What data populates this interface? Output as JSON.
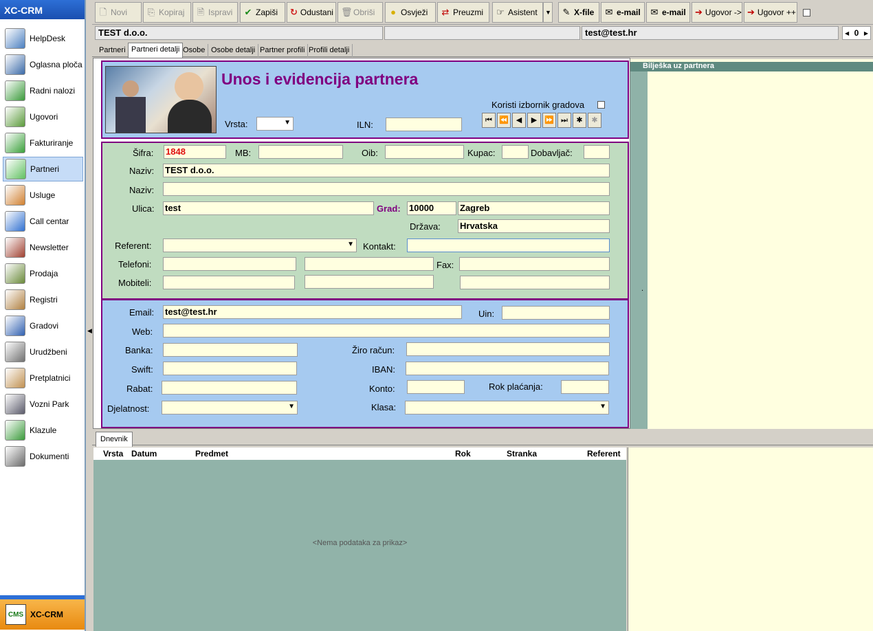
{
  "app": {
    "title": "XC-CRM"
  },
  "sidebar": {
    "items": [
      {
        "label": "HelpDesk"
      },
      {
        "label": "Oglasna ploča"
      },
      {
        "label": "Radni nalozi"
      },
      {
        "label": "Ugovori"
      },
      {
        "label": "Fakturiranje"
      },
      {
        "label": "Partneri"
      },
      {
        "label": "Usluge"
      },
      {
        "label": "Call centar"
      },
      {
        "label": "Newsletter"
      },
      {
        "label": "Prodaja"
      },
      {
        "label": "Registri"
      },
      {
        "label": "Gradovi"
      },
      {
        "label": "Urudžbeni"
      },
      {
        "label": "Pretplatnici"
      },
      {
        "label": "Vozni Park"
      },
      {
        "label": "Klazule"
      },
      {
        "label": "Dokumenti"
      }
    ],
    "active": "Partneri",
    "footer_label": "XC-CRM",
    "footer_logo": "CMS"
  },
  "toolbar": {
    "novi": "Novi",
    "kopiraj": "Kopiraj",
    "ispravi": "Ispravi",
    "zapisi": "Zapiši",
    "odustani": "Odustani",
    "obrisi": "Obriši",
    "osvjezi": "Osvježi",
    "preuzmi": "Preuzmi",
    "asistent": "Asistent",
    "xfile": "X-file",
    "email1": "e-mail",
    "email2": "e-mail",
    "ugovor1": "Ugovor ->",
    "ugovor2": "Ugovor ++"
  },
  "infobar": {
    "partner": "TEST d.o.o.",
    "middle": "",
    "email": "test@test.hr",
    "counter": "0"
  },
  "tabs": [
    "Partneri",
    "Partneri detalji",
    "Osobe",
    "Osobe detalji",
    "Partner profili",
    "Profili detalji"
  ],
  "header": {
    "title": "Unos i evidencija partnera",
    "vrsta_label": "Vrsta:",
    "vrsta_value": "",
    "iln_label": "ILN:",
    "iln_value": "",
    "gradovi_label": "Koristi izbornik gradova"
  },
  "form": {
    "sifra_label": "Šifra:",
    "sifra": "1848",
    "mb_label": "MB:",
    "mb": "",
    "oib_label": "Oib:",
    "oib": "",
    "kupac_label": "Kupac:",
    "kupac": "",
    "dobavljac_label": "Dobavljač:",
    "dobavljac": "",
    "naziv_label": "Naziv:",
    "naziv": "TEST d.o.o.",
    "naziv2_label": "Naziv:",
    "naziv2": "",
    "ulica_label": "Ulica:",
    "ulica": "test",
    "grad_label": "Grad:",
    "postanski": "10000",
    "grad": "Zagreb",
    "drzava_label": "Država:",
    "drzava": "Hrvatska",
    "referent_label": "Referent:",
    "referent": "",
    "kontakt_label": "Kontakt:",
    "kontakt": "",
    "telefoni_label": "Telefoni:",
    "fax_label": "Fax:",
    "mobiteli_label": "Mobiteli:"
  },
  "contact": {
    "email_label": "Email:",
    "email": "test@test.hr",
    "uin_label": "Uin:",
    "uin": "",
    "web_label": "Web:",
    "web": "",
    "banka_label": "Banka:",
    "banka": "",
    "ziro_label": "Žiro račun:",
    "ziro": "",
    "swift_label": "Swift:",
    "swift": "",
    "iban_label": "IBAN:",
    "iban": "",
    "rabat_label": "Rabat:",
    "rabat": "",
    "konto_label": "Konto:",
    "konto": "",
    "rok_label": "Rok plaćanja:",
    "rok": "",
    "djelatnost_label": "Djelatnost:",
    "djelatnost": "",
    "klasa_label": "Klasa:",
    "klasa": ""
  },
  "note": {
    "title": "Bilješka uz partnera",
    "marker": "."
  },
  "dnevnik": {
    "tab": "Dnevnik",
    "columns": [
      "Vrsta",
      "Datum",
      "Predmet",
      "Rok",
      "Stranka",
      "Referent"
    ],
    "empty": "<Nema podataka za prikaz>"
  },
  "colors": {
    "accent": "#800080",
    "sidebar_head": "#2d6fd6",
    "form_green": "#c0dcc0",
    "form_blue": "#a6caf0",
    "field": "#ffffe0"
  }
}
